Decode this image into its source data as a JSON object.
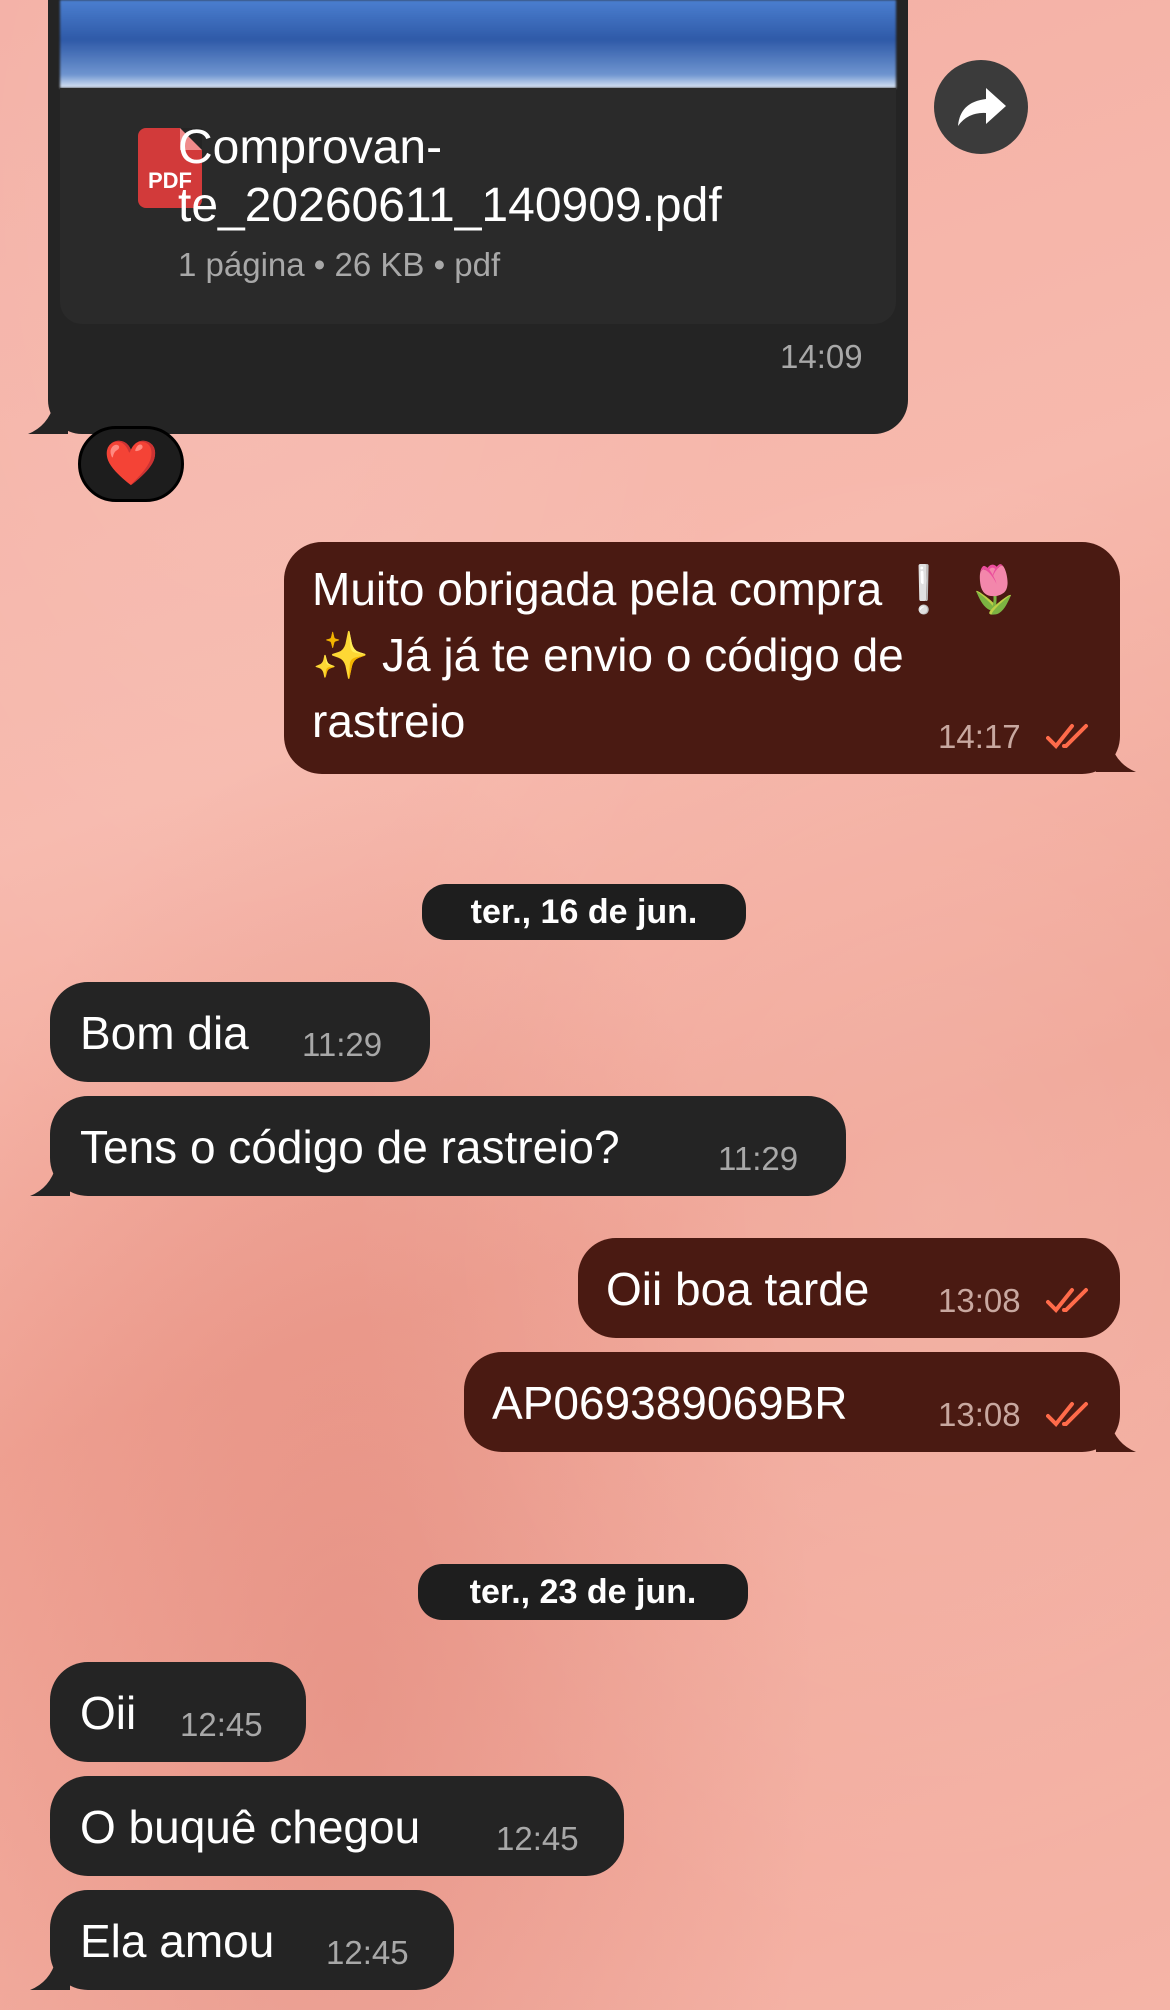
{
  "document_message": {
    "file_name_line1": "Comprovan-",
    "file_name_line2": "te_20260611_140909.pdf",
    "file_meta": "1 página • 26 KB • pdf",
    "pdf_label": "PDF",
    "time": "14:09",
    "reaction": "❤️"
  },
  "messages_day1": {
    "thanks_line1": "Muito obrigada pela compra ❕ 🌷",
    "thanks_line2": "✨ Já já te envio o código de",
    "thanks_line3": "rastreio",
    "thanks_time": "14:17"
  },
  "date_separators": [
    "ter., 16 de jun.",
    "ter., 23 de jun."
  ],
  "messages_day2": [
    {
      "text": "Bom dia",
      "time": "11:29",
      "direction": "incoming"
    },
    {
      "text": "Tens o código de rastreio?",
      "time": "11:29",
      "direction": "incoming"
    },
    {
      "text": "Oii boa tarde",
      "time": "13:08",
      "direction": "outgoing"
    },
    {
      "text": "AP069389069BR",
      "time": "13:08",
      "direction": "outgoing"
    }
  ],
  "messages_day3": [
    {
      "text": "Oii",
      "time": "12:45",
      "direction": "incoming"
    },
    {
      "text": "O buquê chegou",
      "time": "12:45",
      "direction": "incoming"
    },
    {
      "text": "Ela amou",
      "time": "12:45",
      "direction": "incoming"
    }
  ],
  "colors": {
    "incoming_bubble": "#242424",
    "outgoing_bubble": "#4a1a12",
    "read_ticks": "#ff6b4a",
    "wallpaper": "#f3aea3"
  }
}
